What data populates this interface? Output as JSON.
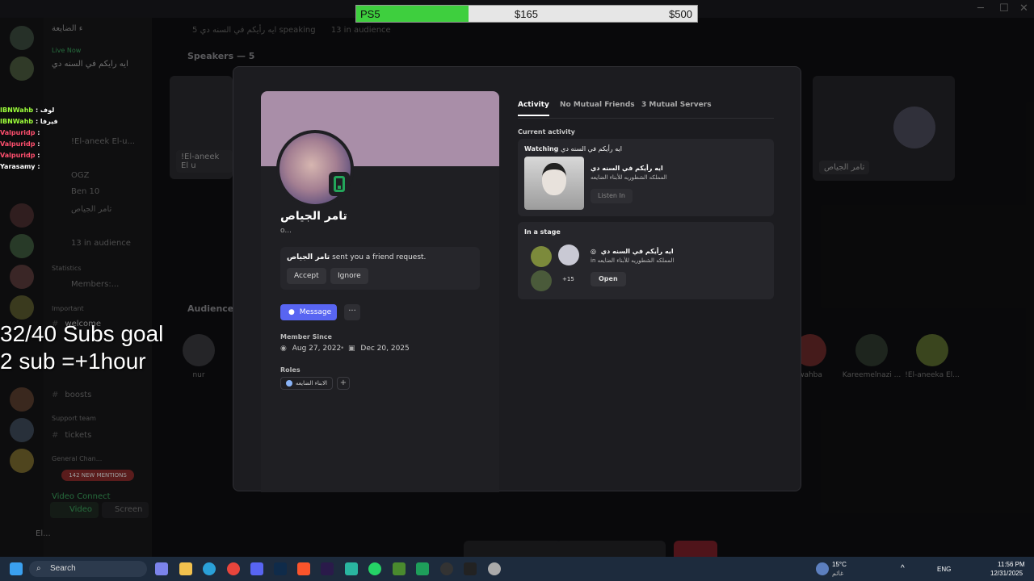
{
  "stream_overlay": {
    "goal_item": "PS5",
    "goal_current": "$165",
    "goal_target": "$500",
    "goal_progress": 0.33,
    "subs_line1": "32/40 Subs goal",
    "subs_line2": "2 sub =+1hour",
    "chat": [
      {
        "user": "IBNWahb",
        "msg": ": لوف",
        "color": "#9dff3a"
      },
      {
        "user": "IBNWahb",
        "msg": ": فيرفا",
        "color": "#9dff3a"
      },
      {
        "user": "Valpuridp",
        "msg": ":",
        "color": "#ff4f6e"
      },
      {
        "user": "Valpuridp",
        "msg": ":",
        "color": "#ff4f6e"
      },
      {
        "user": "Valpuridp",
        "msg": ":",
        "color": "#ff4f6e"
      },
      {
        "user": "Yarasamy",
        "msg": ":",
        "color": "#ffffff"
      }
    ]
  },
  "background": {
    "channel_header": "ايه رأيكم في السنه دي",
    "speaking": "5 speaking",
    "in_audience": "13 in audience",
    "speakers_label": "Speakers — 5",
    "audience_label": "Audience —",
    "tile_left_label": "!El-aneek El u",
    "tile_right_label": "تامر الجياص",
    "server_name": "ء الضايعة",
    "live_now": "Live Now",
    "sidebar_entries": [
      "ايه رأيكم في السنه دي",
      "!El-aneek El-u...",
      "OGZ",
      "Ben 10",
      "تامر الجياص",
      "13 in audience",
      "Statistics",
      "Members:...",
      "Important",
      "welcome",
      "boosts",
      "Support team",
      "tickets",
      "General Chan...",
      "142 NEW MENTIONS"
    ],
    "audience_names": [
      "nur",
      "wahba",
      "Kareemelnazi ...",
      "!El-aneeka El..."
    ],
    "video_connected": "Video Connect",
    "video_btn": "Video",
    "screen_btn": "Screen",
    "user_short": "El..."
  },
  "profile": {
    "display_name": "تامر الجياص",
    "username": "o...",
    "friend_request_name": "تامر الجياص",
    "friend_request_text": "sent you a friend request.",
    "accept_label": "Accept",
    "ignore_label": "Ignore",
    "message_label": "Message",
    "more_label": "···",
    "member_since_label": "Member Since",
    "discord_since": "Aug 27, 2022",
    "server_since": "Dec 20, 2025",
    "roles_label": "Roles",
    "role_name": "الابناء الضايعه",
    "add_role": "+"
  },
  "activity_panel": {
    "tabs": [
      "Activity",
      "No Mutual Friends",
      "3 Mutual Servers"
    ],
    "active_tab": 0,
    "current_activity_label": "Current activity",
    "watching_label": "Watching",
    "watching_stage": "ايه رأيكم في السنه دي",
    "watching_title": "ايه رأيكم في السنه دي",
    "watching_server": "المملكه الشطوريه للأبناء الضايعه",
    "listen_in_label": "Listen In",
    "stage_label": "In a stage",
    "stage_title": "ايه رأيكم في السنه دي",
    "stage_server_prefix": "in",
    "stage_server": "المملكه الشطوريه للأبناء الضايعه",
    "stage_more_count": "+15",
    "open_label": "Open"
  },
  "taskbar": {
    "search_label": "Search",
    "weather_temp": "15°C",
    "weather_desc": "غائم",
    "lang": "ENG",
    "time": "11:56 PM",
    "date": "12/31/2025"
  },
  "colors": {
    "accent": "#5865f2",
    "online_green": "#23a55a",
    "banner": "#a98ea8",
    "goal_fill": "#3ecf3e"
  }
}
